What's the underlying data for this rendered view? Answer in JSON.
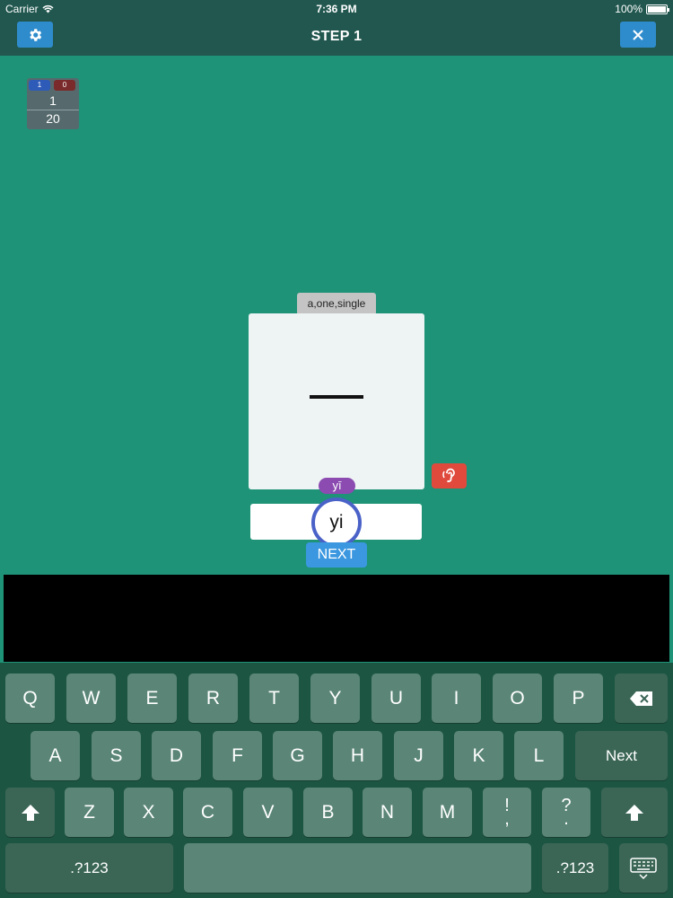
{
  "status_bar": {
    "carrier": "Carrier",
    "time": "7:36 PM",
    "battery": "100%"
  },
  "nav": {
    "title": "STEP 1"
  },
  "score": {
    "correct": "1",
    "wrong": "0",
    "current": "1",
    "total": "20"
  },
  "card": {
    "meaning": "a,one,single",
    "pinyin_hint": "yī"
  },
  "answer": {
    "value": "yi"
  },
  "next_button": {
    "label": "NEXT"
  },
  "keyboard": {
    "row1": [
      "Q",
      "W",
      "E",
      "R",
      "T",
      "Y",
      "U",
      "I",
      "O",
      "P"
    ],
    "row2": [
      "A",
      "S",
      "D",
      "F",
      "G",
      "H",
      "J",
      "K",
      "L"
    ],
    "row3": [
      "Z",
      "X",
      "C",
      "V",
      "B",
      "N",
      "M"
    ],
    "punct1": {
      "top": "!",
      "bottom": ","
    },
    "punct2": {
      "top": "?",
      "bottom": "."
    },
    "next_key": "Next",
    "numbers_key": ".?123"
  },
  "colors": {
    "background": "#1e9377",
    "nav_bar": "#21574f",
    "accent": "#2f8ccc",
    "ear_button": "#e04a3d",
    "pinyin_pill": "#8b4bb1",
    "keyboard": "#1c5542"
  },
  "icons": {
    "settings": "gear-icon",
    "close": "close-icon",
    "listen": "ear-icon",
    "backspace": "backspace-icon",
    "shift": "shift-icon",
    "hide_keyboard": "keyboard-hide-icon"
  }
}
